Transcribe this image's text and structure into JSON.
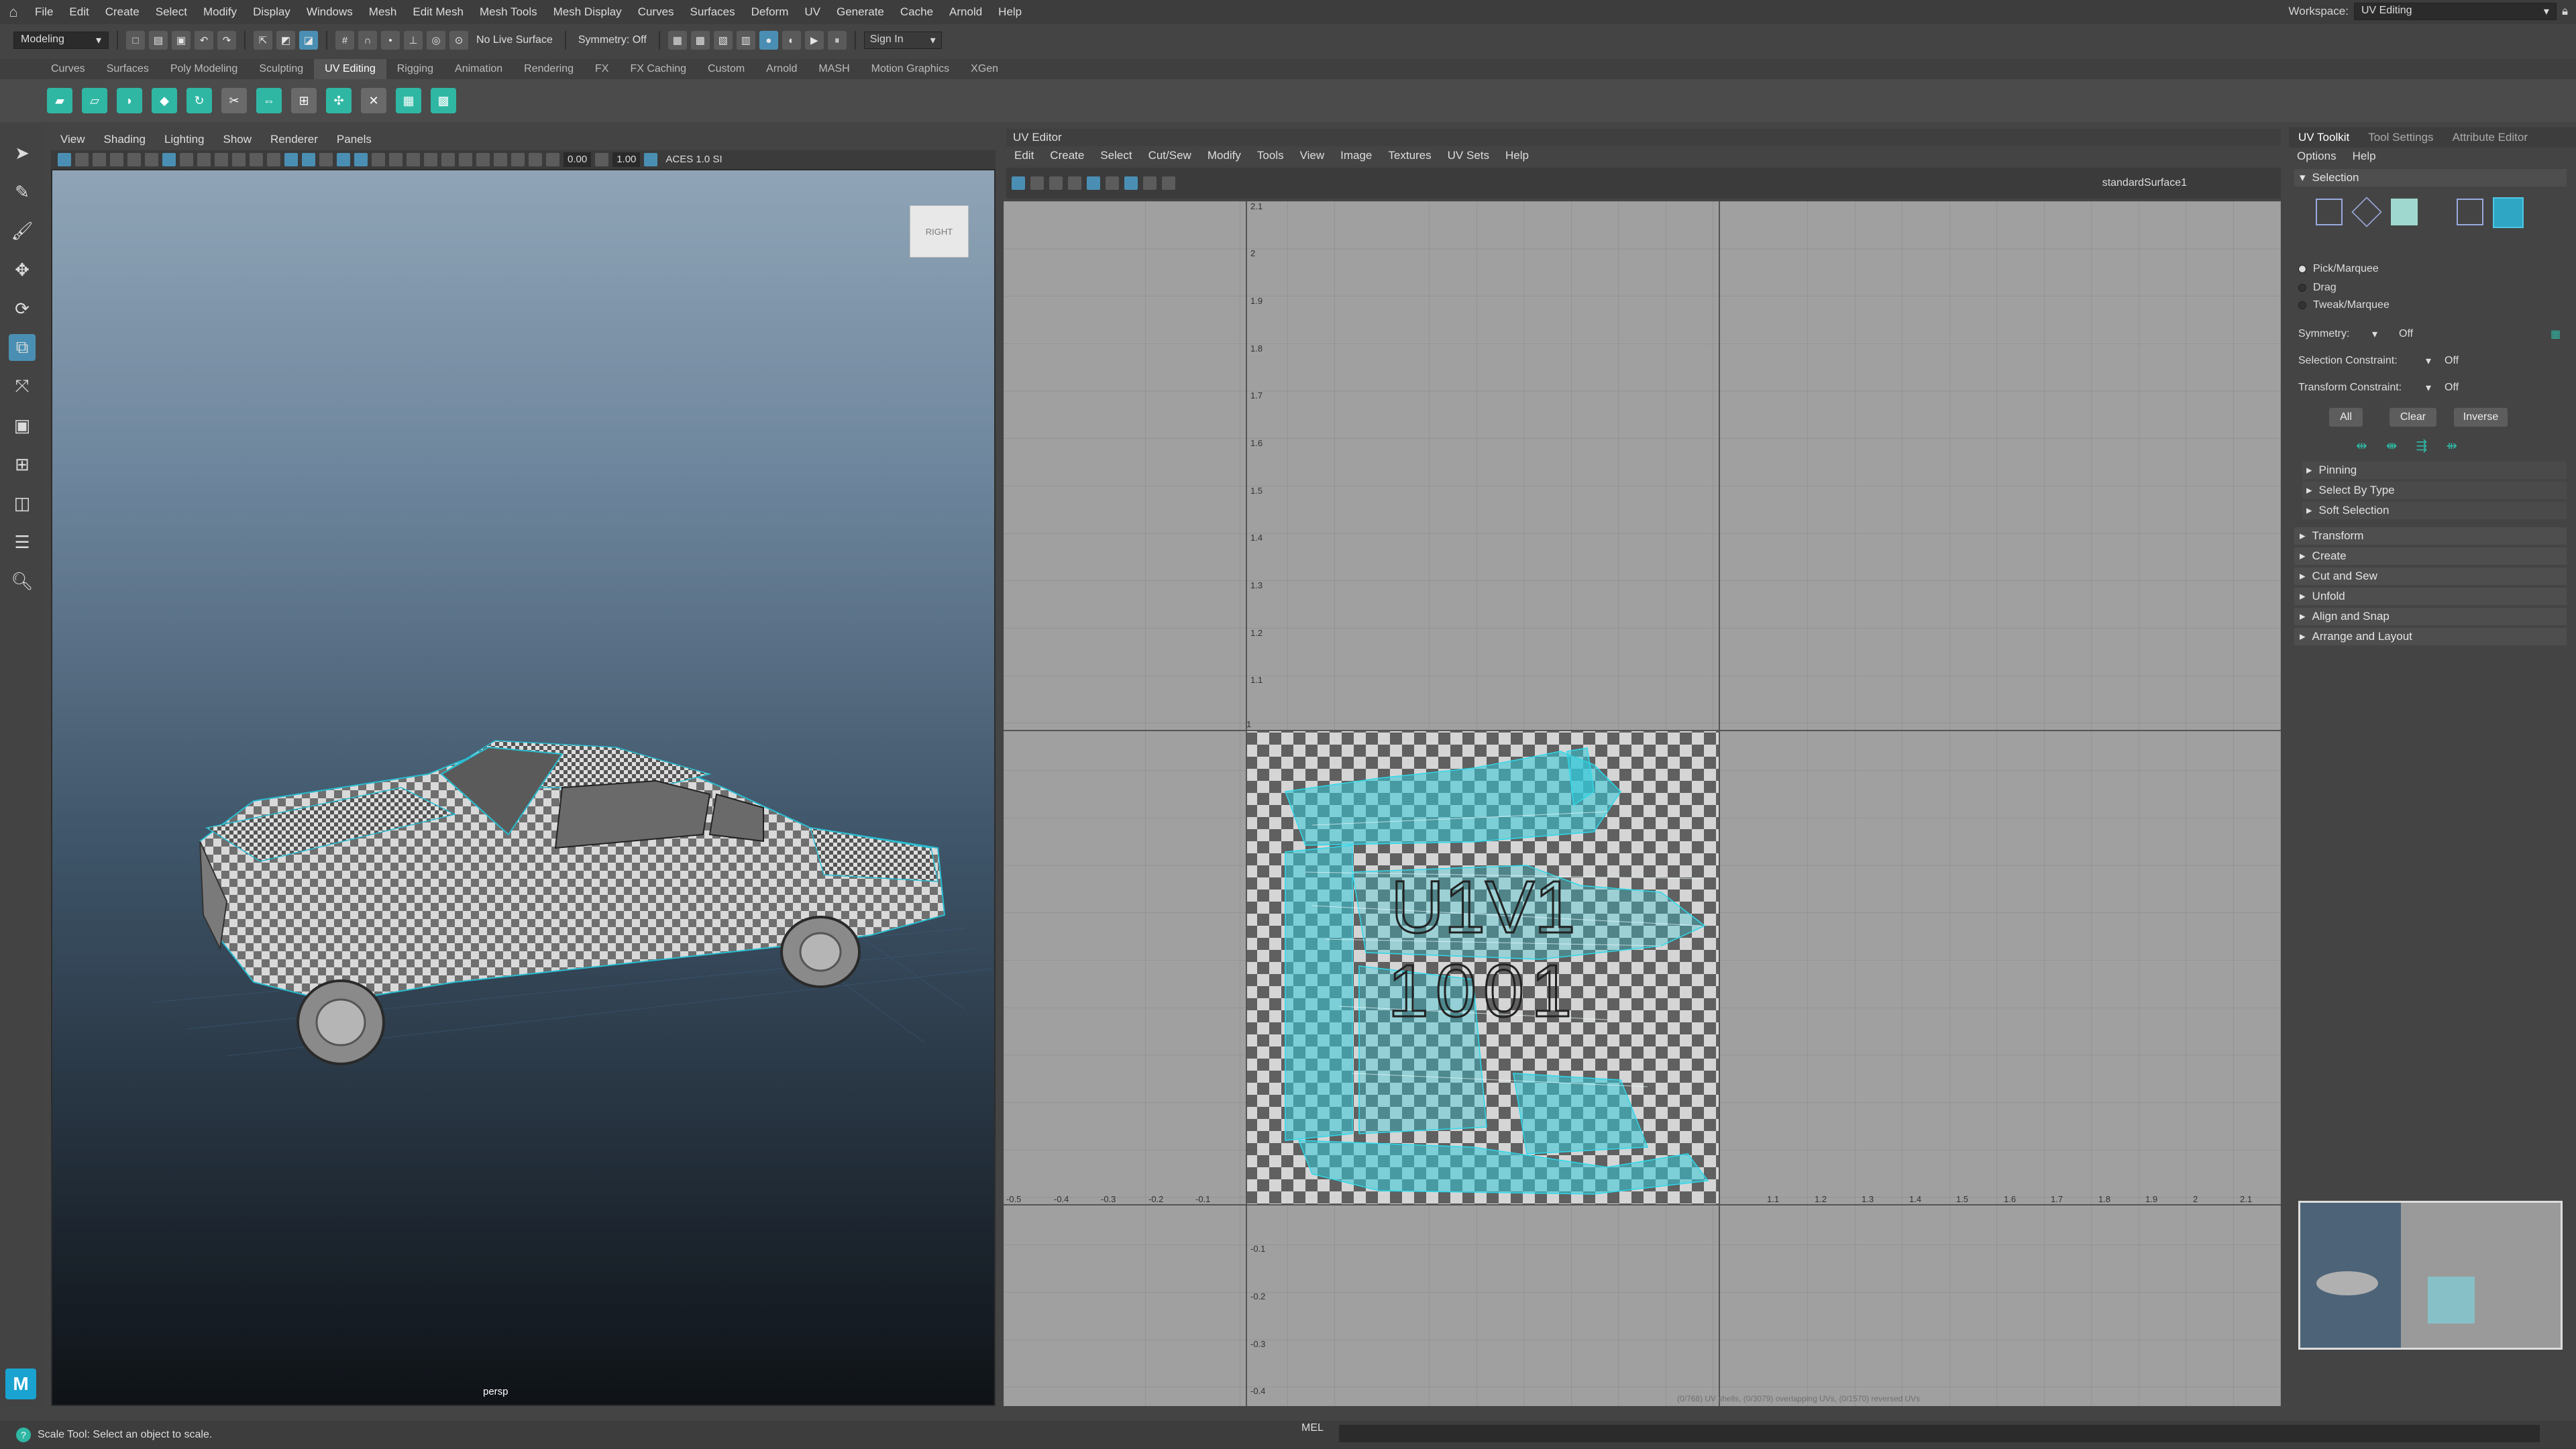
{
  "menubar": {
    "items": [
      "File",
      "Edit",
      "Create",
      "Select",
      "Modify",
      "Display",
      "Windows",
      "Mesh",
      "Edit Mesh",
      "Mesh Tools",
      "Mesh Display",
      "Curves",
      "Surfaces",
      "Deform",
      "UV",
      "Generate",
      "Cache",
      "Arnold",
      "Help"
    ],
    "workspace_label": "Workspace:",
    "workspace_value": "UV Editing"
  },
  "statusline": {
    "mode": "Modeling",
    "live_surface": "No Live Surface",
    "symmetry": "Symmetry: Off",
    "sign_in": "Sign In"
  },
  "shelf": {
    "tabs": [
      "Curves",
      "Surfaces",
      "Poly Modeling",
      "Sculpting",
      "UV Editing",
      "Rigging",
      "Animation",
      "Rendering",
      "FX",
      "FX Caching",
      "Custom",
      "Arnold",
      "MASH",
      "Motion Graphics",
      "XGen"
    ],
    "active_tab": "UV Editing"
  },
  "viewport": {
    "menu": [
      "View",
      "Shading",
      "Lighting",
      "Show",
      "Renderer",
      "Panels"
    ],
    "field1": "0.00",
    "field2": "1.00",
    "color_space": "ACES 1.0 SI",
    "viewcube_label": "RIGHT",
    "camera": "persp"
  },
  "uv_editor": {
    "title": "UV Editor",
    "menu": [
      "Edit",
      "Create",
      "Select",
      "Cut/Sew",
      "Modify",
      "Tools",
      "View",
      "Image",
      "Textures",
      "UV Sets",
      "Help"
    ],
    "shader": "standardSurface1",
    "tile_label_1": "U1V1",
    "tile_label_2": "1001",
    "v_ticks": [
      "2.1",
      "2",
      "1.9",
      "1.8",
      "1.7",
      "1.6",
      "1.5",
      "1.4",
      "1.3",
      "1.2",
      "1.1",
      "1",
      "-0.1",
      "-0.2",
      "-0.3",
      "-0.4"
    ],
    "u_ticks": [
      "-0.5",
      "-0.4",
      "-0.3",
      "-0.2",
      "-0.1",
      "1.1",
      "1.2",
      "1.3",
      "1.4",
      "1.5",
      "1.6",
      "1.7",
      "1.8",
      "1.9",
      "2",
      "2.1"
    ],
    "footer": "(0/768) UV shells, (0/3079) overlapping UVs, (0/1570) reversed UVs"
  },
  "uv_toolkit": {
    "tabs": [
      "UV Toolkit",
      "Tool Settings",
      "Attribute Editor"
    ],
    "menu": [
      "Options",
      "Help"
    ],
    "selection_header": "Selection",
    "radios": [
      "Pick/Marquee",
      "Drag",
      "Tweak/Marquee"
    ],
    "symmetry_label": "Symmetry:",
    "symmetry_value": "Off",
    "sel_constraint_label": "Selection Constraint:",
    "sel_constraint_value": "Off",
    "xform_constraint_label": "Transform Constraint:",
    "xform_constraint_value": "Off",
    "buttons": [
      "All",
      "Clear",
      "Inverse"
    ],
    "subsections": [
      "Pinning",
      "Select By Type",
      "Soft Selection"
    ],
    "sections": [
      "Transform",
      "Create",
      "Cut and Sew",
      "Unfold",
      "Align and Snap",
      "Arrange and Layout"
    ]
  },
  "helpline": {
    "message": "Scale Tool: Select an object to scale.",
    "mel_label": "MEL"
  },
  "colors": {
    "accent": "#2fb7a4",
    "highlight": "#4a8fb3",
    "uv_wire": "#23c4d6"
  }
}
